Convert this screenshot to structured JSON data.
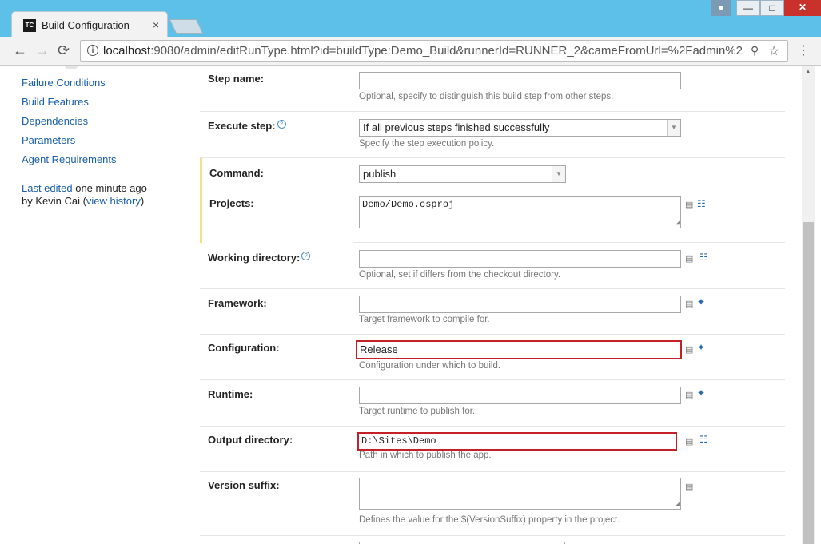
{
  "tab": {
    "title": "Build Configuration —",
    "favicon_text": "TC",
    "close": "×"
  },
  "window": {
    "user_icon": "user-icon",
    "min": "—",
    "max": "□",
    "close": "✕"
  },
  "browser": {
    "back": "←",
    "forward": "→",
    "reload": "⟳",
    "url_host": "localhost",
    "url_path": ":9080/admin/editRunType.html?id=buildType:Demo_Build&runnerId=RUNNER_2&cameFromUrl=%2Fadmin%2",
    "info": "i",
    "menu": "⋮"
  },
  "sidebar": {
    "items": [
      {
        "label": "Failure Conditions"
      },
      {
        "label": "Build Features"
      },
      {
        "label": "Dependencies"
      },
      {
        "label": "Parameters"
      },
      {
        "label": "Agent Requirements"
      }
    ],
    "last_edited_link": "Last edited",
    "last_edited_time": " one minute ago",
    "by_prefix": "by Kevin Cai  (",
    "view_history": "view history",
    "by_suffix": ")"
  },
  "form": {
    "step_name": {
      "label": "Step name:",
      "value": "",
      "hint": "Optional, specify to distinguish this build step from other steps."
    },
    "execute_step": {
      "label": "Execute step:",
      "value": "If all previous steps finished successfully",
      "hint": "Specify the step execution policy."
    },
    "command": {
      "label": "Command:",
      "value": "publish"
    },
    "projects": {
      "label": "Projects:",
      "value": "Demo/Demo.csproj"
    },
    "working_directory": {
      "label": "Working directory:",
      "value": "",
      "hint": "Optional, set if differs from the checkout directory."
    },
    "framework": {
      "label": "Framework:",
      "value": "",
      "hint": "Target framework to compile for."
    },
    "configuration": {
      "label": "Configuration:",
      "value": "Release",
      "hint": "Configuration under which to build."
    },
    "runtime": {
      "label": "Runtime:",
      "value": "",
      "hint": "Target runtime to publish for."
    },
    "output_directory": {
      "label": "Output directory:",
      "value": "D:\\Sites\\Demo",
      "hint": "Path in which to publish the app."
    },
    "version_suffix": {
      "label": "Version suffix:",
      "value": "",
      "hint": "Defines the value for the $(VersionSuffix) property in the project."
    }
  },
  "colors": {
    "highlight": "#c42027",
    "link": "#1a5fa8",
    "titlebar": "#5cc0e8"
  }
}
